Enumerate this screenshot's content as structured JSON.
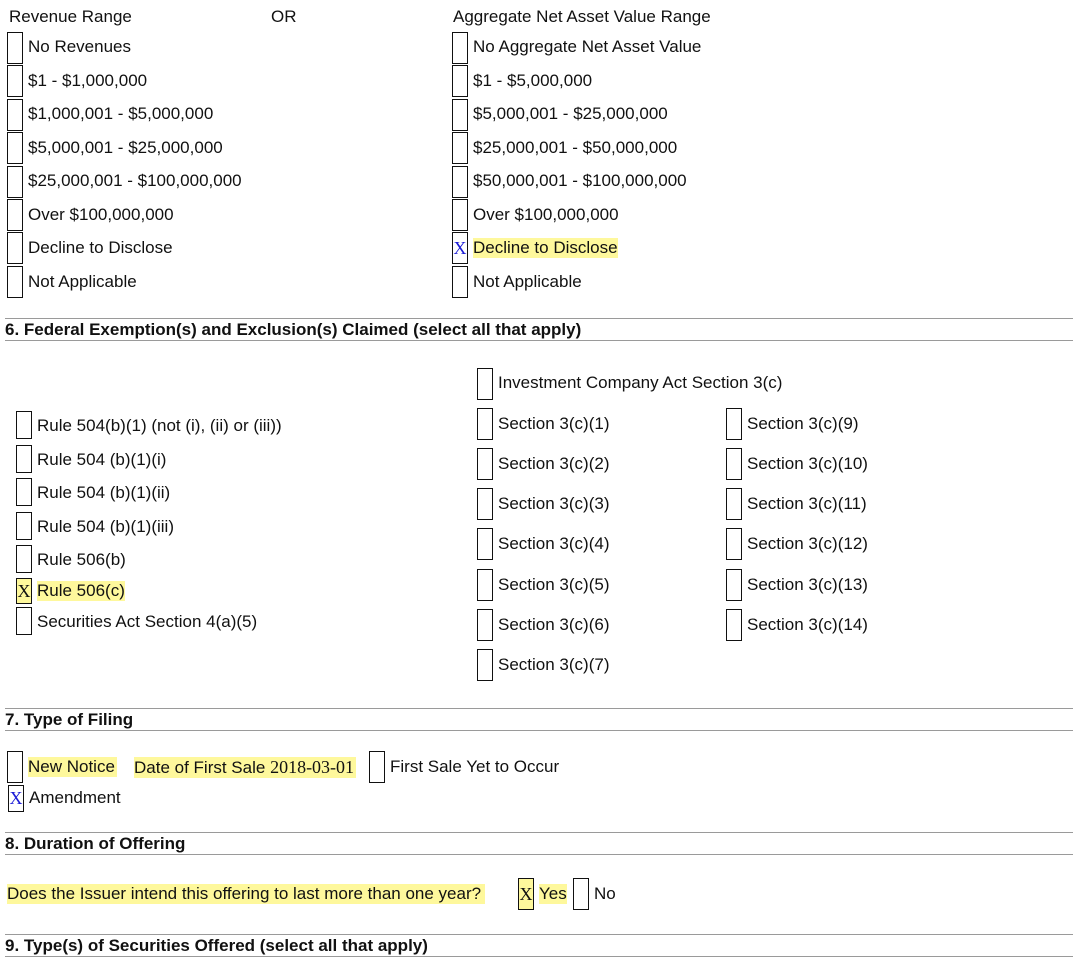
{
  "section5": {
    "revenue_header": "Revenue Range",
    "or_label": "OR",
    "nav_header": "Aggregate Net Asset Value Range",
    "revenue_options": [
      {
        "label": "No Revenues",
        "mark": ""
      },
      {
        "label": "$1 - $1,000,000",
        "mark": ""
      },
      {
        "label": "$1,000,001 - $5,000,000",
        "mark": ""
      },
      {
        "label": "$5,000,001 - $25,000,000",
        "mark": ""
      },
      {
        "label": "$25,000,001 - $100,000,000",
        "mark": ""
      },
      {
        "label": "Over $100,000,000",
        "mark": ""
      },
      {
        "label": "Decline to Disclose",
        "mark": ""
      },
      {
        "label": "Not Applicable",
        "mark": ""
      }
    ],
    "nav_options": [
      {
        "label": "No Aggregate Net Asset Value",
        "mark": ""
      },
      {
        "label": "$1 - $5,000,000",
        "mark": ""
      },
      {
        "label": "$5,000,001 - $25,000,000",
        "mark": ""
      },
      {
        "label": "$25,000,001 - $50,000,000",
        "mark": ""
      },
      {
        "label": "$50,000,001 - $100,000,000",
        "mark": ""
      },
      {
        "label": "Over $100,000,000",
        "mark": ""
      },
      {
        "label": "Decline to Disclose",
        "mark": "X"
      },
      {
        "label": "Not Applicable",
        "mark": ""
      }
    ]
  },
  "section6": {
    "title": "6. Federal Exemption(s) and Exclusion(s) Claimed (select all that apply)",
    "rules": [
      {
        "label": "Rule 504(b)(1) (not (i), (ii) or (iii))",
        "mark": ""
      },
      {
        "label": "Rule 504 (b)(1)(i)",
        "mark": ""
      },
      {
        "label": "Rule 504 (b)(1)(ii)",
        "mark": ""
      },
      {
        "label": "Rule 504 (b)(1)(iii)",
        "mark": ""
      },
      {
        "label": "Rule 506(b)",
        "mark": ""
      },
      {
        "label": "Rule 506(c)",
        "mark": "X"
      },
      {
        "label": "Securities Act Section 4(a)(5)",
        "mark": ""
      }
    ],
    "ica_label": "Investment Company Act Section 3(c)",
    "ica_mark": "",
    "sections_col1": [
      {
        "label": "Section 3(c)(1)",
        "mark": ""
      },
      {
        "label": "Section 3(c)(2)",
        "mark": ""
      },
      {
        "label": "Section 3(c)(3)",
        "mark": ""
      },
      {
        "label": "Section 3(c)(4)",
        "mark": ""
      },
      {
        "label": "Section 3(c)(5)",
        "mark": ""
      },
      {
        "label": "Section 3(c)(6)",
        "mark": ""
      },
      {
        "label": "Section 3(c)(7)",
        "mark": ""
      }
    ],
    "sections_col2": [
      {
        "label": "Section 3(c)(9)",
        "mark": ""
      },
      {
        "label": "Section 3(c)(10)",
        "mark": ""
      },
      {
        "label": "Section 3(c)(11)",
        "mark": ""
      },
      {
        "label": "Section 3(c)(12)",
        "mark": ""
      },
      {
        "label": "Section 3(c)(13)",
        "mark": ""
      },
      {
        "label": "Section 3(c)(14)",
        "mark": ""
      }
    ]
  },
  "section7": {
    "title": "7. Type of Filing",
    "new_notice_label": "New Notice",
    "new_notice_mark": "",
    "date_label": "Date of First Sale",
    "date_value": "2018-03-01",
    "yet_to_occur_label": "First Sale Yet to Occur",
    "yet_to_occur_mark": "",
    "amendment_label": "Amendment",
    "amendment_mark": "X"
  },
  "section8": {
    "title": "8. Duration of Offering",
    "question": "Does the Issuer intend this offering to last more than one year?",
    "yes_mark": "X",
    "yes_label": "Yes",
    "no_mark": "",
    "no_label": "No"
  },
  "section9": {
    "title": "9. Type(s) of Securities Offered (select all that apply)"
  },
  "colors": {
    "highlight": "#fef89c",
    "check_mark_blue": "#1b1bd6",
    "rule_gray": "#9a9a9a"
  }
}
